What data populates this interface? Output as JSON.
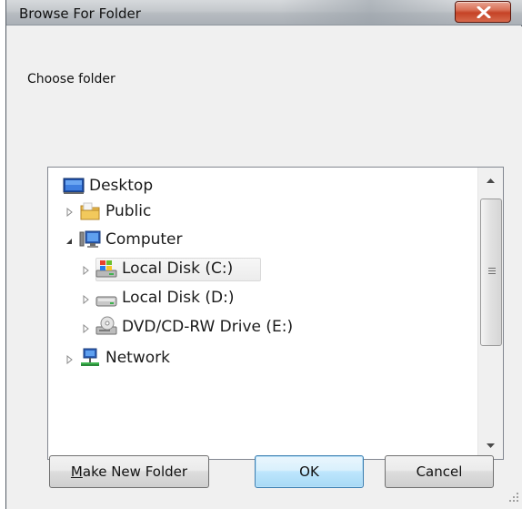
{
  "window": {
    "title": "Browse For Folder",
    "close_glyph": "X"
  },
  "prompt": "Choose folder",
  "tree": {
    "items": [
      {
        "label": "Desktop",
        "icon": "desktop-icon",
        "expander": "none",
        "selected": false
      },
      {
        "label": "Public",
        "icon": "folder-icon",
        "expander": "collapsed",
        "selected": false
      },
      {
        "label": "Computer",
        "icon": "computer-icon",
        "expander": "expanded",
        "selected": false
      },
      {
        "label": "Local Disk (C:)",
        "icon": "windows-drive-icon",
        "expander": "collapsed",
        "selected": true
      },
      {
        "label": "Local Disk (D:)",
        "icon": "hard-drive-icon",
        "expander": "collapsed",
        "selected": false
      },
      {
        "label": "DVD/CD-RW Drive (E:)",
        "icon": "optical-drive-icon",
        "expander": "collapsed",
        "selected": false
      },
      {
        "label": "Network",
        "icon": "network-icon",
        "expander": "collapsed",
        "selected": false
      }
    ]
  },
  "buttons": {
    "make_new_folder": {
      "mnemonic": "M",
      "rest": "ake New Folder"
    },
    "ok": "OK",
    "cancel": "Cancel"
  },
  "colors": {
    "selection": "#ececec",
    "default_button": "#bee6fd",
    "close_button": "#c54326"
  }
}
